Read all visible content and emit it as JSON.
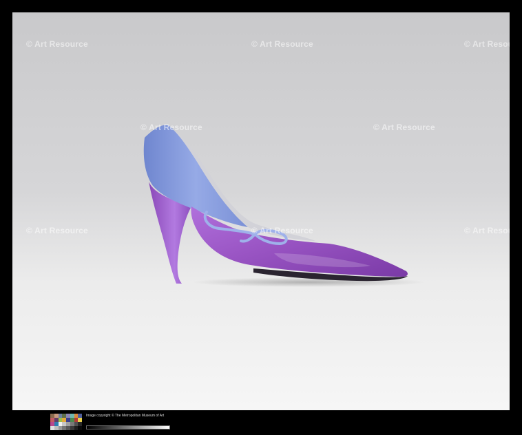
{
  "watermark": {
    "text": "© Art Resource",
    "color": "#ffffff"
  },
  "footer": {
    "copyright": "Image copyright © The Metropolitan Museum of Art",
    "scale_label": "",
    "color_chart": [
      "#8a6a4e",
      "#c99a7e",
      "#6b7fa0",
      "#5f7049",
      "#8c86b3",
      "#6fb8b0",
      "#d98a3a",
      "#4f5f9c",
      "#c45a62",
      "#5e3f6a",
      "#9cbf4a",
      "#e3a83c",
      "#3b3f8f",
      "#4d8a4c",
      "#b23a3a",
      "#e8d14a",
      "#b9488e",
      "#2f7fb0",
      "#f2f2f2",
      "#c8c8c8",
      "#a0a0a0",
      "#787878",
      "#505050",
      "#282828",
      "#e0e0e0",
      "#bdbdbd",
      "#999999",
      "#757575",
      "#575757",
      "#3a3a3a",
      "#1e1e1e",
      "#0a0a0a"
    ]
  },
  "photo": {
    "subject": "purple and periwinkle satin high-heel shoe with bow",
    "colors": {
      "vamp": "#9a55c4",
      "heel_counter": "#7d93d6",
      "lining": "#c9c9cf",
      "sole": "#2a2430"
    }
  }
}
